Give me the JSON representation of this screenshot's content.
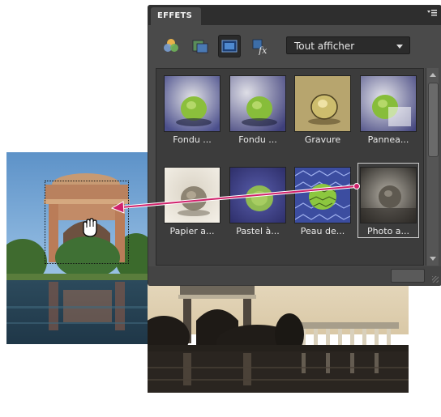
{
  "panel": {
    "tab_label": "EFFETS",
    "menu_icon": "panel-menu-icon",
    "toolbar": {
      "tools": [
        {
          "name": "filters-icon",
          "selected": false
        },
        {
          "name": "layer-styles-icon",
          "selected": false
        },
        {
          "name": "photo-effects-icon",
          "selected": true
        },
        {
          "name": "fx-icon",
          "selected": false
        }
      ],
      "dropdown_value": "Tout afficher"
    },
    "thumbnails": [
      {
        "label": "Fondu ...",
        "style": "fade1"
      },
      {
        "label": "Fondu ...",
        "style": "fade2"
      },
      {
        "label": "Gravure",
        "style": "engrave"
      },
      {
        "label": "Pannea...",
        "style": "panel"
      },
      {
        "label": "Papier a...",
        "style": "paper"
      },
      {
        "label": "Pastel à...",
        "style": "pastel"
      },
      {
        "label": "Peau de...",
        "style": "snake"
      },
      {
        "label": "Photo a...",
        "style": "oldphoto",
        "selected": true
      }
    ]
  },
  "colors": {
    "panel_bg": "#4a4a4a",
    "tabbar_bg": "#2e2e2e",
    "arrow": "#d0216b"
  }
}
